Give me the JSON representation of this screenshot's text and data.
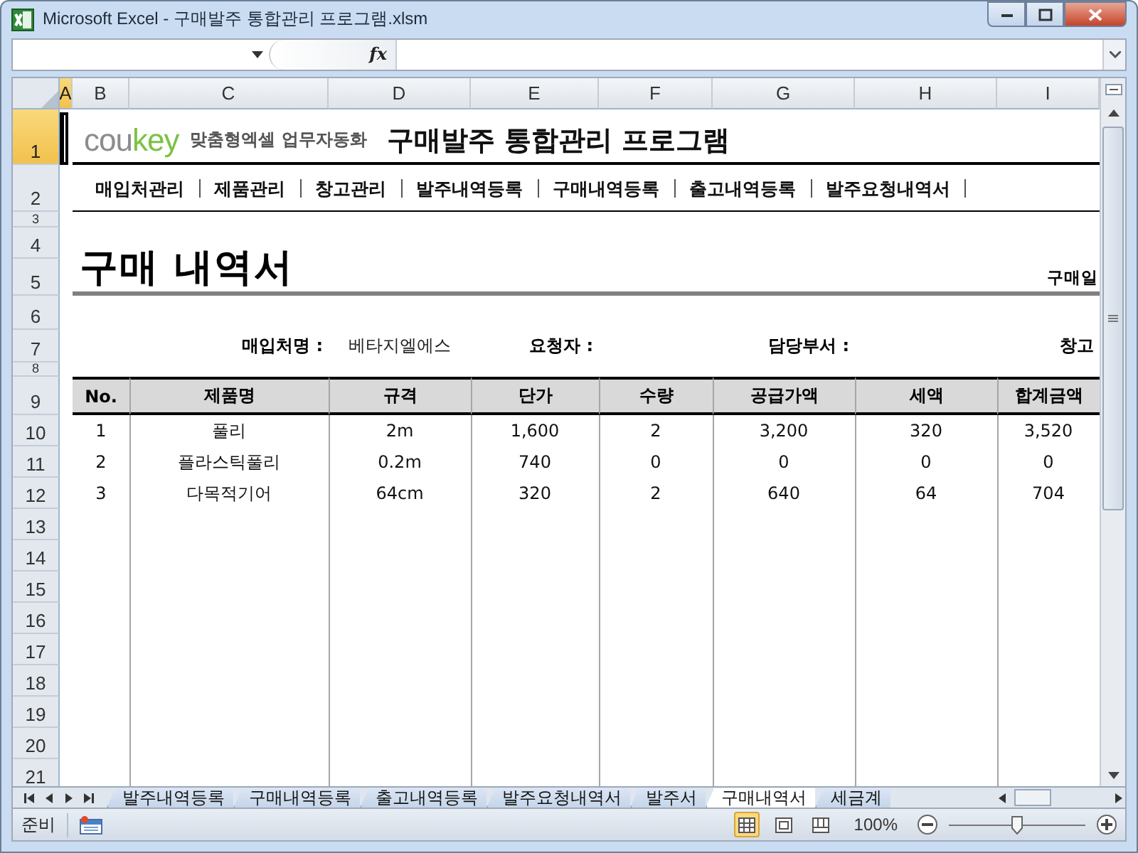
{
  "window": {
    "title": "Microsoft Excel - 구매발주 통합관리 프로그램.xlsm"
  },
  "formula_bar": {
    "fx_label": "fx"
  },
  "column_headers": [
    {
      "label": "A",
      "selected": true
    },
    {
      "label": "B",
      "selected": false
    },
    {
      "label": "C",
      "selected": false
    },
    {
      "label": "D",
      "selected": false
    },
    {
      "label": "E",
      "selected": false
    },
    {
      "label": "F",
      "selected": false
    },
    {
      "label": "G",
      "selected": false
    },
    {
      "label": "H",
      "selected": false
    },
    {
      "label": "I",
      "selected": false
    }
  ],
  "row_headers": [
    {
      "label": "1",
      "selected": true
    },
    {
      "label": "2",
      "selected": false
    },
    {
      "label": "3",
      "selected": false
    },
    {
      "label": "4",
      "selected": false
    },
    {
      "label": "5",
      "selected": false
    },
    {
      "label": "6",
      "selected": false
    },
    {
      "label": "7",
      "selected": false
    },
    {
      "label": "8",
      "selected": false
    },
    {
      "label": "9",
      "selected": false
    },
    {
      "label": "10",
      "selected": false
    },
    {
      "label": "11",
      "selected": false
    },
    {
      "label": "12",
      "selected": false
    },
    {
      "label": "13",
      "selected": false
    },
    {
      "label": "14",
      "selected": false
    },
    {
      "label": "15",
      "selected": false
    },
    {
      "label": "16",
      "selected": false
    },
    {
      "label": "17",
      "selected": false
    },
    {
      "label": "18",
      "selected": false
    },
    {
      "label": "19",
      "selected": false
    },
    {
      "label": "20",
      "selected": false
    },
    {
      "label": "21",
      "selected": false
    }
  ],
  "header": {
    "logo_part_1": "cou",
    "logo_part_2": "key",
    "tagline": "맞춤형엑셀 업무자동화",
    "title": "구매발주 통합관리 프로그램"
  },
  "nav_menu": [
    "매입처관리",
    "제품관리",
    "창고관리",
    "발주내역등록",
    "구매내역등록",
    "출고내역등록",
    "발주요청내역서"
  ],
  "document": {
    "title": "구매 내역서",
    "date_label": "구매일",
    "fields": [
      {
        "label": "매입처명 :",
        "value": "베타지엘에스"
      },
      {
        "label": "요청자 :"
      },
      {
        "label": "담당부서 :"
      },
      {
        "label": "창고"
      }
    ]
  },
  "table": {
    "columns": [
      "No.",
      "제품명",
      "규격",
      "단가",
      "수량",
      "공급가액",
      "세액",
      "합계금액"
    ],
    "rows": [
      [
        "1",
        "풀리",
        "2m",
        "1,600",
        "2",
        "3,200",
        "320",
        "3,520"
      ],
      [
        "2",
        "플라스틱풀리",
        "0.2m",
        "740",
        "0",
        "0",
        "0",
        "0"
      ],
      [
        "3",
        "다목적기어",
        "64cm",
        "320",
        "2",
        "640",
        "64",
        "704"
      ]
    ]
  },
  "sheet_tabs": [
    {
      "label": "발주내역등록",
      "selected": false
    },
    {
      "label": "구매내역등록",
      "selected": false
    },
    {
      "label": "출고내역등록",
      "selected": false
    },
    {
      "label": "발주요청내역서",
      "selected": false
    },
    {
      "label": "발주서",
      "selected": false
    },
    {
      "label": "구매내역서",
      "selected": true
    },
    {
      "label": "세금계",
      "selected": false
    }
  ],
  "status_bar": {
    "mode": "준비",
    "zoom": "100%",
    "zoom_slider": {
      "level": 0.5
    },
    "views": [
      {
        "kind": "normal",
        "selected": true
      },
      {
        "kind": "page-layout",
        "selected": false
      },
      {
        "kind": "page-break",
        "selected": false
      }
    ]
  }
}
